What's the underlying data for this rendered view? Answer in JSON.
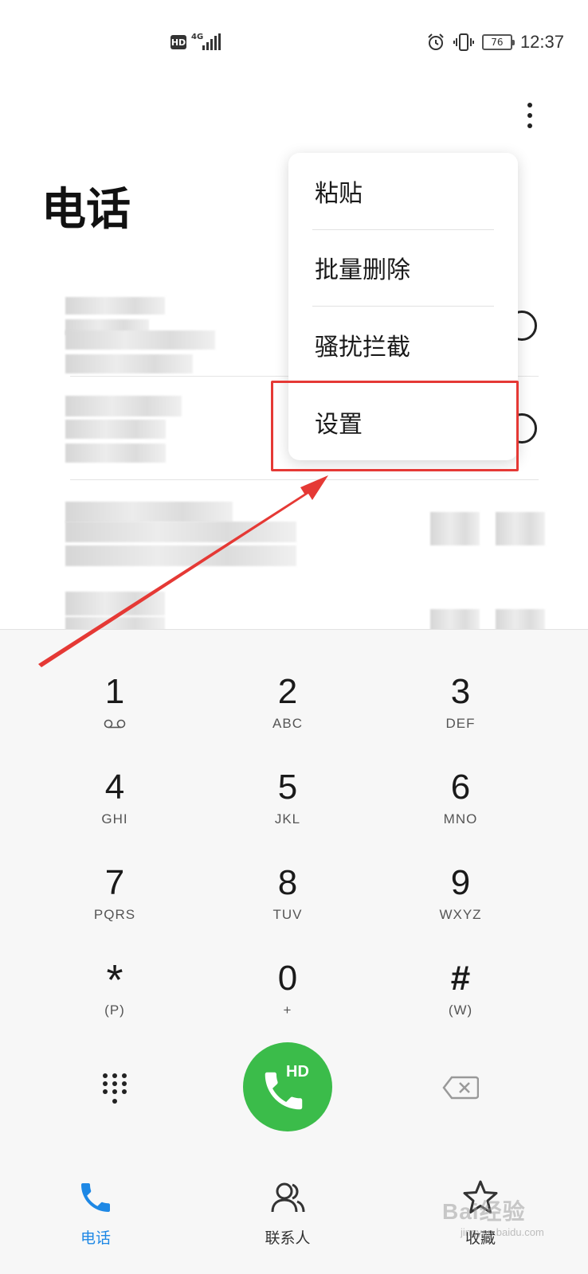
{
  "status_bar": {
    "hd": "HD",
    "network": "4G",
    "battery": "76",
    "time": "12:37"
  },
  "header": {
    "title": "电话"
  },
  "menu": {
    "items": [
      {
        "label": "粘贴"
      },
      {
        "label": "批量删除"
      },
      {
        "label": "骚扰拦截"
      },
      {
        "label": "设置"
      }
    ]
  },
  "dialpad": {
    "keys": [
      {
        "digit": "1",
        "letters": ""
      },
      {
        "digit": "2",
        "letters": "ABC"
      },
      {
        "digit": "3",
        "letters": "DEF"
      },
      {
        "digit": "4",
        "letters": "GHI"
      },
      {
        "digit": "5",
        "letters": "JKL"
      },
      {
        "digit": "6",
        "letters": "MNO"
      },
      {
        "digit": "7",
        "letters": "PQRS"
      },
      {
        "digit": "8",
        "letters": "TUV"
      },
      {
        "digit": "9",
        "letters": "WXYZ"
      },
      {
        "digit": "*",
        "letters": "(P)"
      },
      {
        "digit": "0",
        "letters": "+"
      },
      {
        "digit": "#",
        "letters": "(W)"
      }
    ],
    "call_label": "HD"
  },
  "bottom_nav": {
    "items": [
      {
        "label": "电话",
        "icon": "phone-icon",
        "active": true
      },
      {
        "label": "联系人",
        "icon": "contacts-icon",
        "active": false
      },
      {
        "label": "收藏",
        "icon": "star-icon",
        "active": false
      }
    ]
  },
  "watermark": {
    "text": "Bai经验",
    "sub": "jingyan.baidu.com"
  },
  "colors": {
    "accent": "#1e88e5",
    "call_green": "#3bbc4a",
    "highlight_red": "#e53935"
  }
}
